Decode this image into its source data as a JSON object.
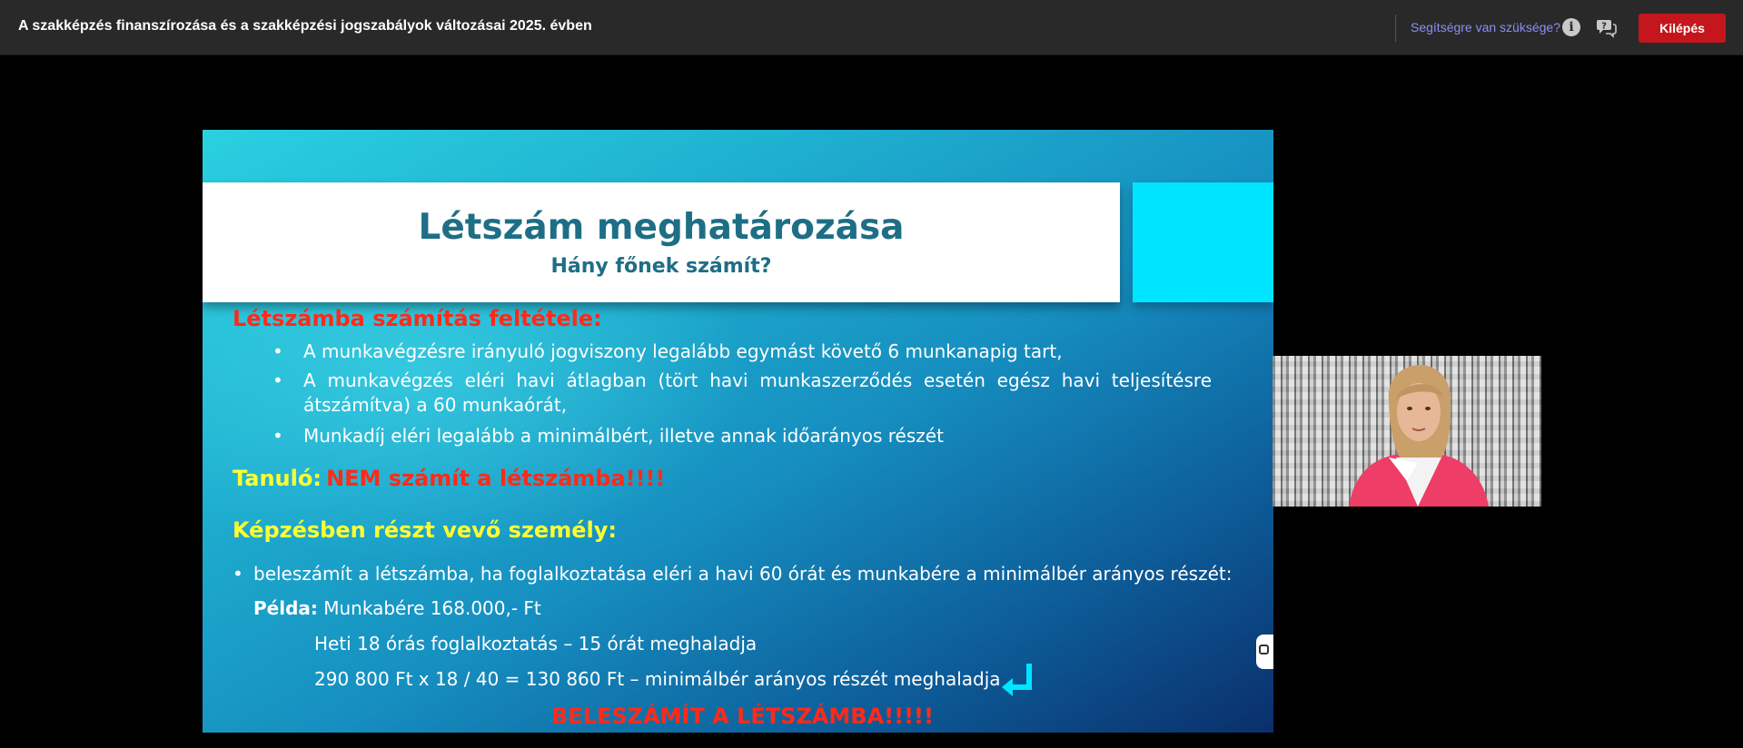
{
  "header": {
    "title": "A szakképzés finanszírozása és a szakképzési jogszabályok változásai 2025. évben",
    "help_link": "Segítségre van szüksége?",
    "info_icon": "info-icon",
    "chat_help_icon": "chat-help-icon",
    "exit_button": "Kilépés"
  },
  "slide": {
    "title": "Létszám meghatározása",
    "subtitle": "Hány főnek számít?",
    "condition_heading": "Létszámba számítás feltétele:",
    "conditions": [
      "A munkavégzésre irányuló jogviszony legalább egymást követő 6 munkanapig tart,",
      "A munkavégzés eléri havi átlagban (tört havi munkaszerződés esetén egész havi teljesítésre átszámítva) a 60 munkaórát,",
      "Munkadíj eléri legalább a minimálbért, illetve annak időarányos részét"
    ],
    "student_label": "Tanuló:",
    "student_text": "NEM számít a létszámba!!!!",
    "trainee_heading": "Képzésben részt vevő személy:",
    "trainee_bullet": "beleszámít a létszámba, ha foglalkoztatása eléri a havi 60 órát és munkabére a minimálbér arányos részét:",
    "example_label": "Példa:",
    "example_line1": "Munkabére 168.000,- Ft",
    "example_line2": "Heti 18 órás foglalkoztatás – 15 órát meghaladja",
    "example_line3": "290 800 Ft x 18 / 40 = 130 860 Ft – minimálbér arányos részét meghaladja",
    "conclusion": "BELESZÁMÍT A LÉTSZÁMBA!!!!!",
    "bullet_char": "•"
  },
  "colors": {
    "exit_button": "#c4161c",
    "help_link": "#8b8ff2",
    "slide_title": "#1e6e86",
    "red_text": "#ff2a1a",
    "yellow_text": "#ffff33",
    "cyan_accent": "#00e5ff"
  }
}
